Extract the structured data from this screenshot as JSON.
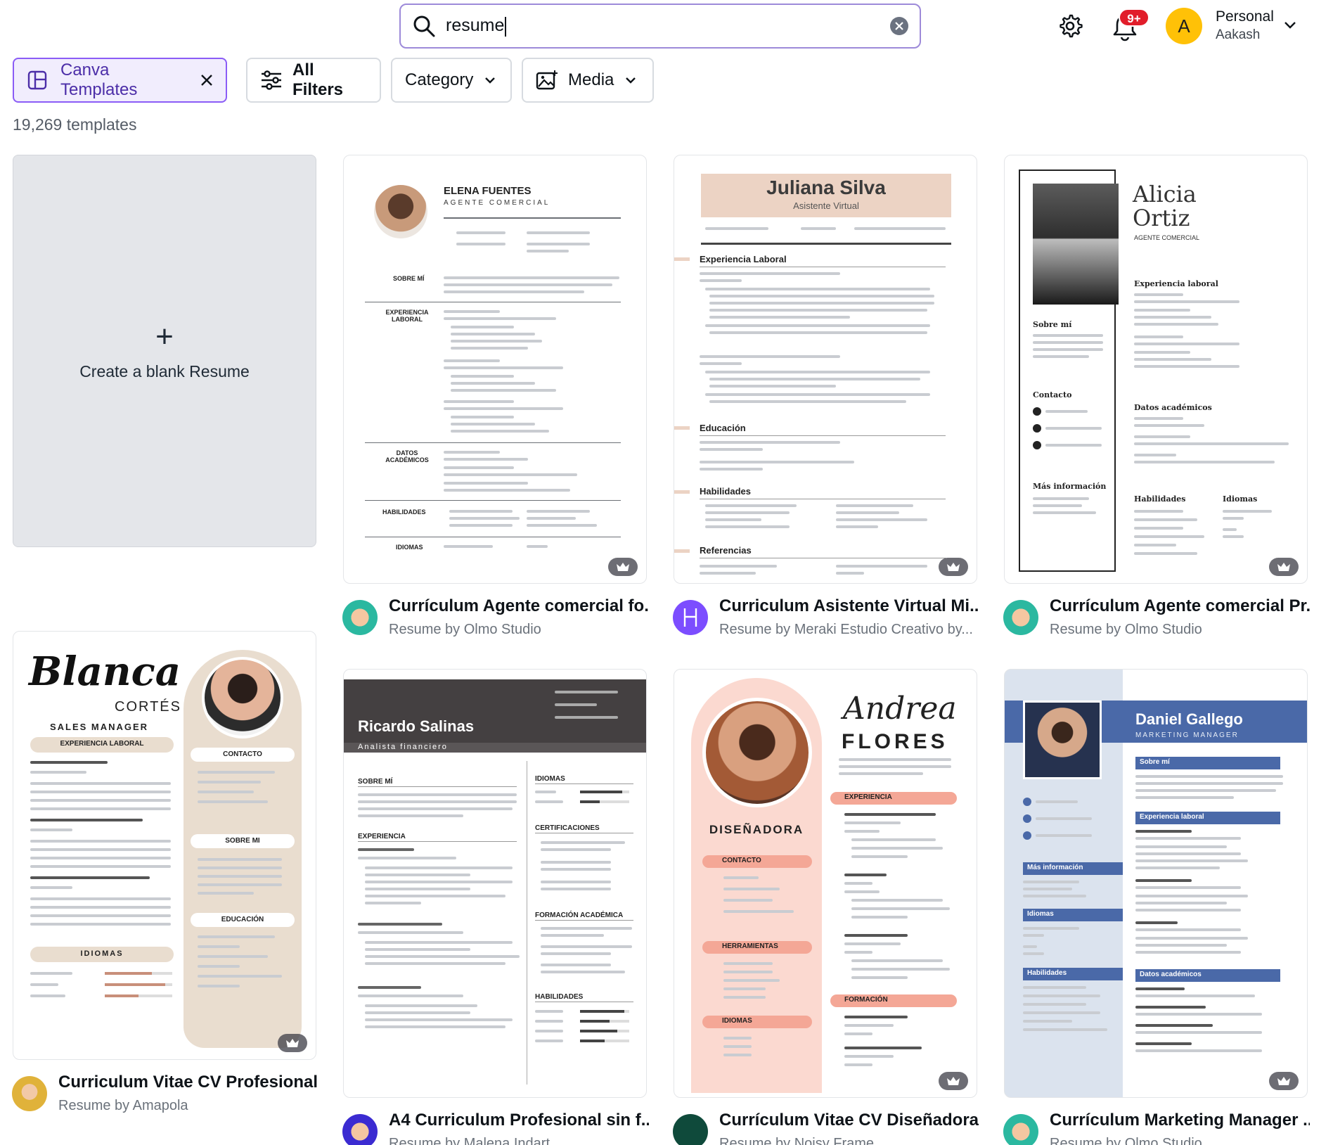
{
  "search": {
    "value": "resume"
  },
  "header": {
    "notifications_badge": "9+",
    "account_initial": "A",
    "account_name": "Personal",
    "account_user": "Aakash",
    "avatar_color": "#ffc107"
  },
  "filters": {
    "canva_templates": "Canva Templates",
    "all_filters": "All Filters",
    "category": "Category",
    "media": "Media"
  },
  "results_count": "19,269 templates",
  "blank": {
    "label": "Create a blank Resume"
  },
  "templates": [
    {
      "title": "Currículum Agente comercial fo...",
      "subtitle": "Resume by Olmo Studio",
      "preview": {
        "name": "ELENA FUENTES",
        "role": "AGENTE COMERCIAL",
        "sections": [
          "SOBRE MÍ",
          "EXPERIENCIA LABORAL",
          "DATOS ACADÉMICOS",
          "HABILIDADES",
          "IDIOMAS"
        ]
      }
    },
    {
      "title": "Curriculum Asistente Virtual Mi...",
      "subtitle": "Resume by Meraki Estudio Creativo by...",
      "preview": {
        "name": "Juliana Silva",
        "role": "Asistente Virtual",
        "sections": [
          "Experiencia Laboral",
          "Educación",
          "Habilidades",
          "Referencias"
        ]
      }
    },
    {
      "title": "Currículum Agente comercial Pr...",
      "subtitle": "Resume by Olmo Studio",
      "preview": {
        "name": "Alicia Ortiz",
        "role": "AGENTE COMERCIAL",
        "sections": [
          "Sobre mí",
          "Contacto",
          "Más información",
          "Experiencia laboral",
          "Datos académicos",
          "Habilidades",
          "Idiomas"
        ]
      }
    },
    {
      "title": "Curriculum Vitae CV Profesional...",
      "subtitle": "Resume by Amapola",
      "preview": {
        "name": "Blanca",
        "surname": "CORTÉS",
        "role": "SALES MANAGER",
        "sections": [
          "EXPERIENCIA LABORAL",
          "CONTACTO",
          "SOBRE MI",
          "EDUCACIÓN",
          "IDIOMAS"
        ]
      }
    },
    {
      "title": "A4 Curriculum Profesional sin f...",
      "subtitle": "Resume by Malena Indart",
      "preview": {
        "name": "Ricardo Salinas",
        "role": "Analista financiero",
        "sections": [
          "SOBRE MÍ",
          "EXPERIENCIA",
          "IDIOMAS",
          "CERTIFICACIONES",
          "FORMACIÓN ACADÉMICA",
          "HABILIDADES"
        ]
      }
    },
    {
      "title": "Currículum Vitae CV Diseñadora...",
      "subtitle": "Resume by Noisy Frame",
      "preview": {
        "name": "Andrea",
        "surname": "FLORES",
        "role": "DISEÑADORA",
        "sections": [
          "EXPERIENCIA",
          "CONTACTO",
          "HERRAMIENTAS",
          "IDIOMAS",
          "FORMACIÓN"
        ]
      }
    },
    {
      "title": "Currículum Marketing Manager ...",
      "subtitle": "Resume by Olmo Studio",
      "preview": {
        "name": "Daniel Gallego",
        "role": "MARKETING MANAGER",
        "sections": [
          "Sobre mí",
          "Experiencia laboral",
          "Más información",
          "Idiomas",
          "Habilidades",
          "Datos académicos"
        ]
      }
    }
  ]
}
